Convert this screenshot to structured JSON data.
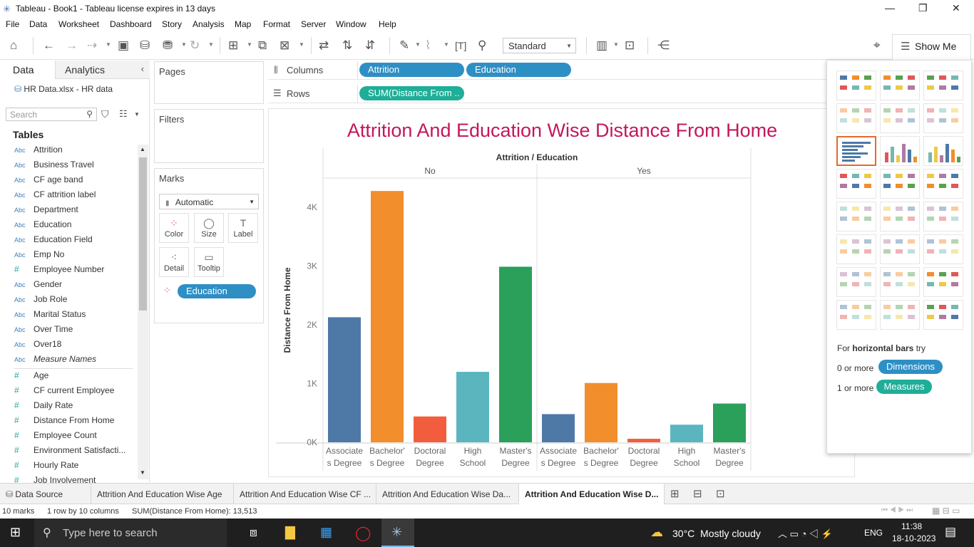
{
  "window": {
    "title": "Tableau - Book1 - Tableau license expires in 13 days"
  },
  "menu": [
    "File",
    "Data",
    "Worksheet",
    "Dashboard",
    "Story",
    "Analysis",
    "Map",
    "Format",
    "Server",
    "Window",
    "Help"
  ],
  "toolbar": {
    "fit_mode": "Standard",
    "show_me": "Show Me"
  },
  "left_panel": {
    "tab_data": "Data",
    "tab_analytics": "Analytics",
    "datasource": "HR Data.xlsx - HR data",
    "search_placeholder": "Search",
    "tables_header": "Tables",
    "dimensions": [
      {
        "type": "Abc",
        "name": "Attrition"
      },
      {
        "type": "Abc",
        "name": "Business Travel"
      },
      {
        "type": "Abc",
        "name": "CF age band"
      },
      {
        "type": "Abc",
        "name": "CF attrition label"
      },
      {
        "type": "Abc",
        "name": "Department"
      },
      {
        "type": "Abc",
        "name": "Education"
      },
      {
        "type": "Abc",
        "name": "Education Field"
      },
      {
        "type": "Abc",
        "name": "Emp No"
      },
      {
        "type": "#",
        "name": "Employee Number"
      },
      {
        "type": "Abc",
        "name": "Gender"
      },
      {
        "type": "Abc",
        "name": "Job Role"
      },
      {
        "type": "Abc",
        "name": "Marital Status"
      },
      {
        "type": "Abc",
        "name": "Over Time"
      },
      {
        "type": "Abc",
        "name": "Over18"
      },
      {
        "type": "Abc",
        "name": "Measure Names"
      }
    ],
    "measures": [
      {
        "type": "#",
        "name": "Age"
      },
      {
        "type": "#",
        "name": "CF current Employee"
      },
      {
        "type": "#",
        "name": "Daily Rate"
      },
      {
        "type": "#",
        "name": "Distance From Home"
      },
      {
        "type": "#",
        "name": "Employee Count"
      },
      {
        "type": "#",
        "name": "Environment Satisfacti..."
      },
      {
        "type": "#",
        "name": "Hourly Rate"
      },
      {
        "type": "#",
        "name": "Job Involvement"
      }
    ]
  },
  "cards": {
    "pages": "Pages",
    "filters": "Filters",
    "marks": "Marks",
    "mark_type": "Automatic",
    "mark_buttons": {
      "color": "Color",
      "size": "Size",
      "label": "Label",
      "detail": "Detail",
      "tooltip": "Tooltip"
    },
    "color_pill": "Education"
  },
  "shelves": {
    "columns_label": "Columns",
    "rows_label": "Rows",
    "columns": [
      "Attrition",
      "Education"
    ],
    "rows": [
      "SUM(Distance From .."
    ]
  },
  "chart_data": {
    "type": "bar",
    "title": "Attrition And Education Wise Distance From Home",
    "header": "Attrition / Education",
    "groups": [
      "No",
      "Yes"
    ],
    "categories": [
      "Associate s Degree",
      "Bachelor' s Degree",
      "Doctoral Degree",
      "High School",
      "Master's Degree"
    ],
    "category_lines": [
      [
        "Associate",
        "s Degree"
      ],
      [
        "Bachelor'",
        "s Degree"
      ],
      [
        "Doctoral",
        "Degree"
      ],
      [
        "High",
        "School"
      ],
      [
        "Master's",
        "Degree"
      ]
    ],
    "series": [
      {
        "name": "No",
        "values": [
          2130,
          4280,
          440,
          1200,
          2990
        ]
      },
      {
        "name": "Yes",
        "values": [
          480,
          1010,
          60,
          300,
          660
        ]
      }
    ],
    "colors": [
      "#4e79a7",
      "#f28e2b",
      "#f25e3d",
      "#5bb5bf",
      "#2aa05a"
    ],
    "ylabel": "Distance From Home",
    "ylim": [
      0,
      4500
    ],
    "yticks": [
      0,
      1000,
      2000,
      3000,
      4000
    ],
    "ytick_labels": [
      "0K",
      "1K",
      "2K",
      "3K",
      "4K"
    ]
  },
  "showme": {
    "hint_prefix": "For ",
    "hint_bold": "horizontal bars",
    "hint_suffix": " try",
    "dim_count": "0 or more",
    "dim_label": "Dimensions",
    "meas_count": "1 or more",
    "meas_label": "Measures"
  },
  "sheet_tabs": {
    "datasource": "Data Source",
    "tabs": [
      "Attrition And Education Wise Age",
      "Attrition And Education Wise CF ...",
      "Attrition And Education Wise Da...",
      "Attrition And Education Wise D..."
    ]
  },
  "status": {
    "marks": "10 marks",
    "layout": "1 row by 10 columns",
    "sum": "SUM(Distance From Home): 13,513"
  },
  "taskbar": {
    "search": "Type here to search",
    "weather": "30°C  Mostly cloudy",
    "lang": "ENG",
    "time": "11:38",
    "date": "18-10-2023"
  }
}
